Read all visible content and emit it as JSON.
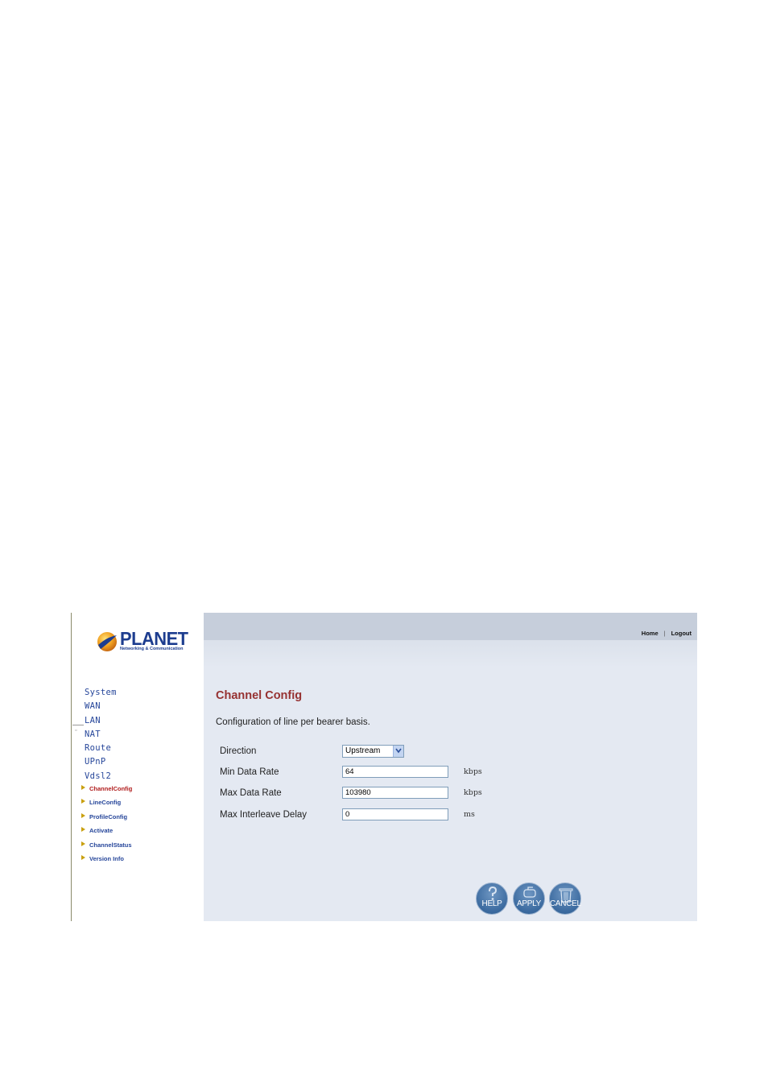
{
  "brand": {
    "name": "PLANET",
    "tagline": "Networking & Communication"
  },
  "header": {
    "home": "Home",
    "separator": "|",
    "logout": "Logout"
  },
  "nav": {
    "items": [
      "System",
      "WAN",
      "LAN",
      "NAT",
      "Route",
      "UPnP",
      "Vdsl2"
    ]
  },
  "subnav": {
    "items": [
      "ChannelConfig",
      "LineConfig",
      "ProfileConfig",
      "Activate",
      "ChannelStatus",
      "Version Info"
    ],
    "active_index": 0
  },
  "page": {
    "title": "Channel Config",
    "description": "Configuration of line per bearer basis."
  },
  "form": {
    "direction": {
      "label": "Direction",
      "value": "Upstream"
    },
    "min_rate": {
      "label": "Min Data Rate",
      "value": "64",
      "unit": "kbps"
    },
    "max_rate": {
      "label": "Max Data Rate",
      "value": "103980",
      "unit": "kbps"
    },
    "max_delay": {
      "label": "Max Interleave Delay",
      "value": "0",
      "unit": "ms"
    }
  },
  "buttons": {
    "help": "HELP",
    "apply": "APPLY",
    "cancel": "CANCEL"
  },
  "colors": {
    "title": "#963232",
    "nav": "#26469a",
    "button": "#3b6a9f",
    "content_bg": "#e4e9f2"
  }
}
